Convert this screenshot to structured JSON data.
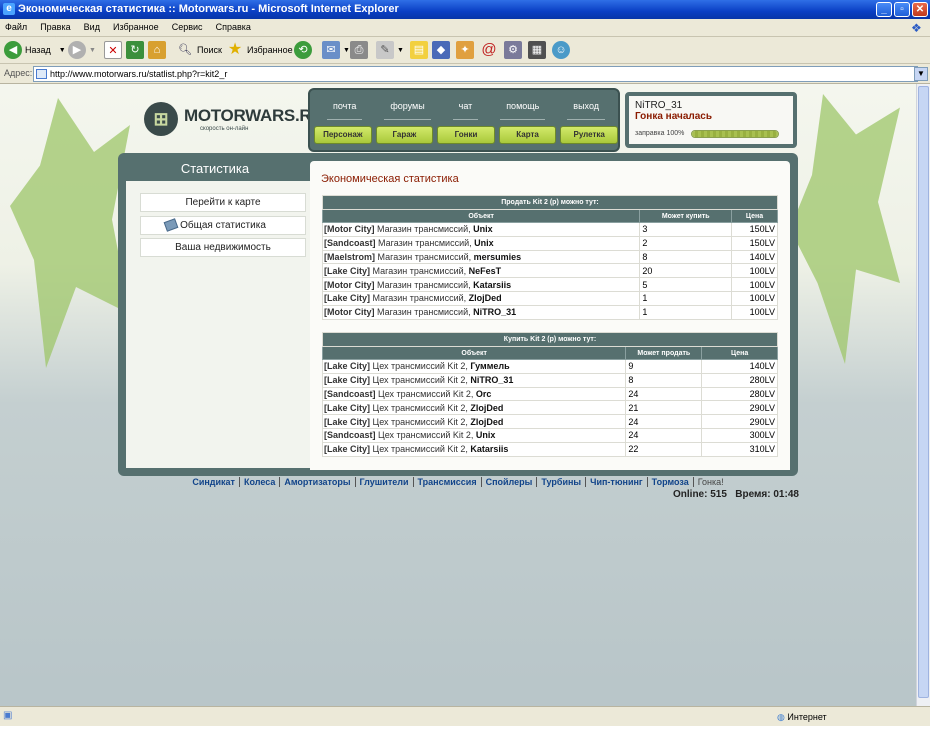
{
  "window": {
    "title": "Экономическая статистика :: Motorwars.ru - Microsoft Internet Explorer"
  },
  "menu": [
    "Файл",
    "Правка",
    "Вид",
    "Избранное",
    "Сервис",
    "Справка"
  ],
  "toolbar": {
    "back": "Назад",
    "search": "Поиск",
    "favorites": "Избранное"
  },
  "address": {
    "label": "Адрес:",
    "url": "http://www.motorwars.ru/statlist.php?r=kit2_r"
  },
  "site": {
    "name": "MOTORWARS.RU",
    "slogan": "скорость он-лайн"
  },
  "nav_top": [
    "почта",
    "форумы",
    "чат",
    "помощь",
    "выход"
  ],
  "nav_bottom": [
    "Персонаж",
    "Гараж",
    "Гонки",
    "Карта",
    "Рулетка"
  ],
  "user": {
    "nick": "NiTRO_31",
    "status": "Гонка началась",
    "fuel_label": "заправка 100%",
    "fuel_pct": 100
  },
  "sidebar": {
    "title": "Статистика",
    "items": [
      "Перейти к карте",
      "Общая статистика",
      "Ваша недвижимость"
    ]
  },
  "content": {
    "title": "Экономическая статистика"
  },
  "sell_table": {
    "caption": "Продать Kit 2 (р) можно тут:",
    "headers": [
      "Объект",
      "Может купить",
      "Цена"
    ],
    "rows": [
      {
        "city": "[Motor City]",
        "shop": "Магазин трансмиссий,",
        "owner": "Unix",
        "qty": "3",
        "price": "150LV"
      },
      {
        "city": "[Sandcoast]",
        "shop": "Магазин трансмиссий,",
        "owner": "Unix",
        "qty": "2",
        "price": "150LV"
      },
      {
        "city": "[Maelstrom]",
        "shop": "Магазин трансмиссий,",
        "owner": "mersumies",
        "qty": "8",
        "price": "140LV"
      },
      {
        "city": "[Lake City]",
        "shop": "Магазин трансмиссий,",
        "owner": "NeFesT",
        "qty": "20",
        "price": "100LV"
      },
      {
        "city": "[Motor City]",
        "shop": "Магазин трансмиссий,",
        "owner": "Katarsiis",
        "qty": "5",
        "price": "100LV"
      },
      {
        "city": "[Lake City]",
        "shop": "Магазин трансмиссий,",
        "owner": "ZlojDed",
        "qty": "1",
        "price": "100LV"
      },
      {
        "city": "[Motor City]",
        "shop": "Магазин трансмиссий,",
        "owner": "NiTRO_31",
        "qty": "1",
        "price": "100LV"
      }
    ]
  },
  "buy_table": {
    "caption": "Купить Kit 2 (р) можно тут:",
    "headers": [
      "Объект",
      "Может продать",
      "Цена"
    ],
    "rows": [
      {
        "city": "[Lake City]",
        "shop": "Цех трансмиссий Kit 2,",
        "owner": "Гуммель",
        "qty": "9",
        "price": "140LV"
      },
      {
        "city": "[Lake City]",
        "shop": "Цех трансмиссий Kit 2,",
        "owner": "NiTRO_31",
        "qty": "8",
        "price": "280LV"
      },
      {
        "city": "[Sandcoast]",
        "shop": "Цех трансмиссий Kit 2,",
        "owner": "Orc",
        "qty": "24",
        "price": "280LV"
      },
      {
        "city": "[Lake City]",
        "shop": "Цех трансмиссий Kit 2,",
        "owner": "ZlojDed",
        "qty": "21",
        "price": "290LV"
      },
      {
        "city": "[Lake City]",
        "shop": "Цех трансмиссий Kit 2,",
        "owner": "ZlojDed",
        "qty": "24",
        "price": "290LV"
      },
      {
        "city": "[Sandcoast]",
        "shop": "Цех трансмиссий Kit 2,",
        "owner": "Unix",
        "qty": "24",
        "price": "300LV"
      },
      {
        "city": "[Lake City]",
        "shop": "Цех трансмиссий Kit 2,",
        "owner": "Katarsiis",
        "qty": "22",
        "price": "310LV"
      }
    ]
  },
  "footer": {
    "links": [
      "Синдикат",
      "Колеса",
      "Амортизаторы",
      "Глушители",
      "Трансмиссия",
      "Спойлеры",
      "Турбины",
      "Чип-тюнинг",
      "Тормоза"
    ],
    "current": "Гонка!",
    "online_label": "Online:",
    "online_count": "515",
    "time_label": "Время:",
    "time_value": "01:48"
  },
  "status": {
    "zone": "Интернет"
  },
  "colors": {
    "panel": "#56706f",
    "accent_text": "#8a1b00",
    "button": "#c4e054",
    "link": "#12448a"
  }
}
